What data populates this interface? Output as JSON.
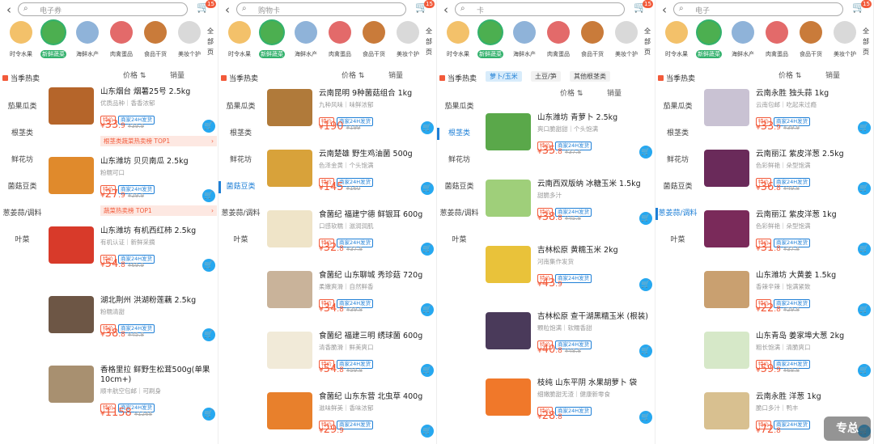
{
  "panels": [
    {
      "search_text": "电子券",
      "cart_badge": "15",
      "categories": [
        {
          "label": "时令水果",
          "color": "#f3c16a",
          "selected": false
        },
        {
          "label": "新鲜蔬菜",
          "color": "#4caf50",
          "selected": true
        },
        {
          "label": "海鲜水产",
          "color": "#8fb3d9",
          "selected": false
        },
        {
          "label": "肉禽蛋品",
          "color": "#e36a6a",
          "selected": false
        },
        {
          "label": "食品干货",
          "color": "#c97b3a",
          "selected": false
        },
        {
          "label": "美妆个护",
          "color": "#d9d9d9",
          "selected": false
        }
      ],
      "all_label": "全部页",
      "side_title": "当季热卖",
      "side_items": [
        "茄果瓜类",
        "根茎类",
        "鲜花坊",
        "菌菇豆类",
        "葱姜蒜/调料",
        "叶菜"
      ],
      "active_index": -1,
      "sort_price": "价格",
      "sort_volume": "销量",
      "chips": [],
      "products": [
        {
          "name": "山东烟台 烟薯25号 2.5kg",
          "desc": "优质品种｜香香浓郁",
          "tags": [
            "特价",
            "商家24H发货"
          ],
          "price_int": "33",
          "price_dec": ".9",
          "orig": "¥39.9",
          "promo": "根茎类蔬菜热卖榜 TOP1",
          "color": "#b5652a"
        },
        {
          "name": "山东潍坊 贝贝南瓜 2.5kg",
          "desc": "粉糯可口",
          "tags": [
            "特价",
            "商家24H发货"
          ],
          "price_int": "27",
          "price_dec": ".9",
          "orig": "¥29.9",
          "promo": "蔬菜热卖榜 TOP1",
          "color": "#e08a2c"
        },
        {
          "name": "山东潍坊 有机西红柿 2.5kg",
          "desc": "有机认证｜新鲜采摘",
          "tags": [
            "特价",
            "商家24H发货"
          ],
          "price_int": "54",
          "price_dec": ".8",
          "orig": "¥69.9",
          "promo": "",
          "color": "#d83a2a"
        },
        {
          "name": "湖北荆州 洪湖粉莲藕 2.5kg",
          "desc": "粉糯清甜",
          "tags": [
            "特价",
            "商家24H发货"
          ],
          "price_int": "38",
          "price_dec": ".8",
          "orig": "¥45.8",
          "promo": "",
          "color": "#6d5645"
        },
        {
          "name": "香格里拉 鲜野生松茸500g(单果10cm+)",
          "desc": "顺丰航空包邮｜可刷身",
          "tags": [
            "特价",
            "商家24H发货"
          ],
          "price_int": "1158",
          "price_dec": "",
          "orig": "¥1268",
          "promo": "",
          "color": "#a89070"
        }
      ]
    },
    {
      "search_text": "购物卡",
      "cart_badge": "15",
      "categories": [
        {
          "label": "时令水果",
          "color": "#f3c16a",
          "selected": false
        },
        {
          "label": "新鲜蔬菜",
          "color": "#4caf50",
          "selected": true
        },
        {
          "label": "海鲜水产",
          "color": "#8fb3d9",
          "selected": false
        },
        {
          "label": "肉禽蛋品",
          "color": "#e36a6a",
          "selected": false
        },
        {
          "label": "食品干货",
          "color": "#c97b3a",
          "selected": false
        },
        {
          "label": "美妆个护",
          "color": "#d9d9d9",
          "selected": false
        }
      ],
      "all_label": "全部页",
      "side_title": "当季热卖",
      "side_items": [
        "茄果瓜类",
        "根茎类",
        "鲜花坊",
        "菌菇豆类",
        "葱姜蒜/调料",
        "叶菜"
      ],
      "active_index": 3,
      "sort_price": "价格",
      "sort_volume": "销量",
      "chips": [],
      "products": [
        {
          "name": "云南昆明 9种菌菇组合 1kg",
          "desc": "九种风味｜味鲜浓郁",
          "tags": [
            "特价",
            "商家24H发货"
          ],
          "price_int": "190",
          "price_dec": "",
          "orig": "¥199",
          "promo": "",
          "color": "#b07a3a"
        },
        {
          "name": "云南楚雄 野生鸡油菌 500g",
          "desc": "色泽金黄｜个头饱满",
          "tags": [
            "特价",
            "商家24H发货"
          ],
          "price_int": "145",
          "price_dec": "",
          "orig": "¥160",
          "promo": "",
          "color": "#d8a23a"
        },
        {
          "name": "食菌纪 福建宁德 鲜银耳 600g",
          "desc": "口感软糯｜滋润润肌",
          "tags": [
            "特价",
            "商家24H发货"
          ],
          "price_int": "32",
          "price_dec": ".8",
          "orig": "¥37.8",
          "promo": "",
          "color": "#efe4c8"
        },
        {
          "name": "食菌纪 山东聊城 秀珍菇 720g",
          "desc": "柔嫩爽滑｜自然鲜香",
          "tags": [
            "特价",
            "商家24H发货"
          ],
          "price_int": "34",
          "price_dec": ".8",
          "orig": "¥39.8",
          "promo": "",
          "color": "#c9b39a"
        },
        {
          "name": "食菌纪 福建三明 绣球菌 600g",
          "desc": "清香脆滑｜鲜美爽口",
          "tags": [
            "特价",
            "商家24H发货"
          ],
          "price_int": "54",
          "price_dec": ".8",
          "orig": "¥59.8",
          "promo": "",
          "color": "#f1ead8"
        },
        {
          "name": "食菌纪 山东东营 北虫草 400g",
          "desc": "滋味鲜美｜香味浓郁",
          "tags": [
            "特价",
            "商家24H发货"
          ],
          "price_int": "29",
          "price_dec": ".9",
          "orig": "",
          "promo": "",
          "color": "#e8802c"
        }
      ]
    },
    {
      "search_text": "卡",
      "cart_badge": "15",
      "categories": [
        {
          "label": "时令水果",
          "color": "#f3c16a",
          "selected": false
        },
        {
          "label": "新鲜蔬菜",
          "color": "#4caf50",
          "selected": true
        },
        {
          "label": "海鲜水产",
          "color": "#8fb3d9",
          "selected": false
        },
        {
          "label": "肉禽蛋品",
          "color": "#e36a6a",
          "selected": false
        },
        {
          "label": "食品干货",
          "color": "#c97b3a",
          "selected": false
        },
        {
          "label": "美妆个护",
          "color": "#d9d9d9",
          "selected": false
        }
      ],
      "all_label": "全部页",
      "side_title": "当季热卖",
      "side_items": [
        "茄果瓜类",
        "根茎类",
        "鲜花坊",
        "菌菇豆类",
        "葱姜蒜/调料",
        "叶菜"
      ],
      "active_index": 1,
      "sort_price": "价格",
      "sort_volume": "销量",
      "chips": [
        "萝卜/玉米",
        "土豆/笋",
        "其他根茎类"
      ],
      "products": [
        {
          "name": "山东潍坊 青萝卜 2.5kg",
          "desc": "爽口脆甜甜｜个头饱满",
          "tags": [
            "特价",
            "商家24H发货"
          ],
          "price_int": "35",
          "price_dec": ".8",
          "orig": "¥37.8",
          "promo": "",
          "color": "#5aa84a"
        },
        {
          "name": "云南西双版纳 冰糖玉米 1.5kg",
          "desc": "甜脆多汁",
          "tags": [
            "特价",
            "商家24H发货"
          ],
          "price_int": "38",
          "price_dec": ".8",
          "orig": "¥45.8",
          "promo": "",
          "color": "#9fcf7a"
        },
        {
          "name": "吉林松原 黄糯玉米 2kg",
          "desc": "河南集作发货",
          "tags": [
            "特价",
            "商家24H发货"
          ],
          "price_int": "43",
          "price_dec": ".9",
          "orig": "",
          "promo": "",
          "color": "#e9c23a"
        },
        {
          "name": "吉林松原 查干湖黑糯玉米 (根装)",
          "desc": "颗粒饱满｜软糯香甜",
          "tags": [
            "特价",
            "商家24H发货"
          ],
          "price_int": "40",
          "price_dec": ".8",
          "orig": "¥48.8",
          "promo": "",
          "color": "#4a3a5a"
        },
        {
          "name": "枝纯 山东平阴 水果胡萝卜 袋",
          "desc": "细嫩脆甜无渣｜健康新零食",
          "tags": [
            "特价",
            "商家24H发货"
          ],
          "price_int": "28",
          "price_dec": ".8",
          "orig": "",
          "promo": "",
          "color": "#f0782a"
        }
      ]
    },
    {
      "search_text": "电子",
      "cart_badge": "15",
      "categories": [
        {
          "label": "时令水果",
          "color": "#f3c16a",
          "selected": false
        },
        {
          "label": "新鲜蔬菜",
          "color": "#4caf50",
          "selected": true
        },
        {
          "label": "海鲜水产",
          "color": "#8fb3d9",
          "selected": false
        },
        {
          "label": "肉禽蛋品",
          "color": "#e36a6a",
          "selected": false
        },
        {
          "label": "食品干货",
          "color": "#c97b3a",
          "selected": false
        },
        {
          "label": "美妆个护",
          "color": "#d9d9d9",
          "selected": false
        }
      ],
      "all_label": "全部页",
      "side_title": "当季热卖",
      "side_items": [
        "茄果瓜类",
        "根茎类",
        "鲜花坊",
        "菌菇豆类",
        "葱姜蒜/调料",
        "叶菜"
      ],
      "active_index": 4,
      "sort_price": "价格",
      "sort_volume": "销量",
      "chips": [],
      "products": [
        {
          "name": "云南永胜 独头蒜 1kg",
          "desc": "云南包邮｜吃起来过瘾",
          "tags": [
            "特价",
            "商家24H发货"
          ],
          "price_int": "33",
          "price_dec": ".9",
          "orig": "¥39.9",
          "promo": "",
          "color": "#c9c2d3"
        },
        {
          "name": "云南丽江 紫皮洋葱 2.5kg",
          "desc": "色彩鲜艳｜朵型饱满",
          "tags": [
            "特价",
            "商家24H发货"
          ],
          "price_int": "36",
          "price_dec": ".8",
          "orig": "¥49.8",
          "promo": "",
          "color": "#6a2a5a"
        },
        {
          "name": "云南丽江 紫皮洋葱 1kg",
          "desc": "色彩鲜艳｜朵型饱满",
          "tags": [
            "特价",
            "商家24H发货"
          ],
          "price_int": "31",
          "price_dec": ".8",
          "orig": "¥37.8",
          "promo": "",
          "color": "#7a2a5a"
        },
        {
          "name": "山东潍坊 大黄姜 1.5kg",
          "desc": "香辣辛辣｜饱满紧致",
          "tags": [
            "特价",
            "商家24H发货"
          ],
          "price_int": "22",
          "price_dec": ".8",
          "orig": "¥29.8",
          "promo": "",
          "color": "#c9a070"
        },
        {
          "name": "山东青岛 姜家埠大葱 2kg",
          "desc": "粗长饱满｜清脆爽口",
          "tags": [
            "特价",
            "商家24H发货"
          ],
          "price_int": "59",
          "price_dec": ".9",
          "orig": "¥68.8",
          "promo": "",
          "color": "#d6e8c8"
        },
        {
          "name": "云南永胜 洋葱 1kg",
          "desc": "脆口多汁｜鸭丰",
          "tags": [
            "特价",
            "商家24H发货"
          ],
          "price_int": "72",
          "price_dec": ".8",
          "orig": "",
          "promo": "",
          "color": "#d8c090"
        }
      ]
    }
  ],
  "watermark": "专总"
}
